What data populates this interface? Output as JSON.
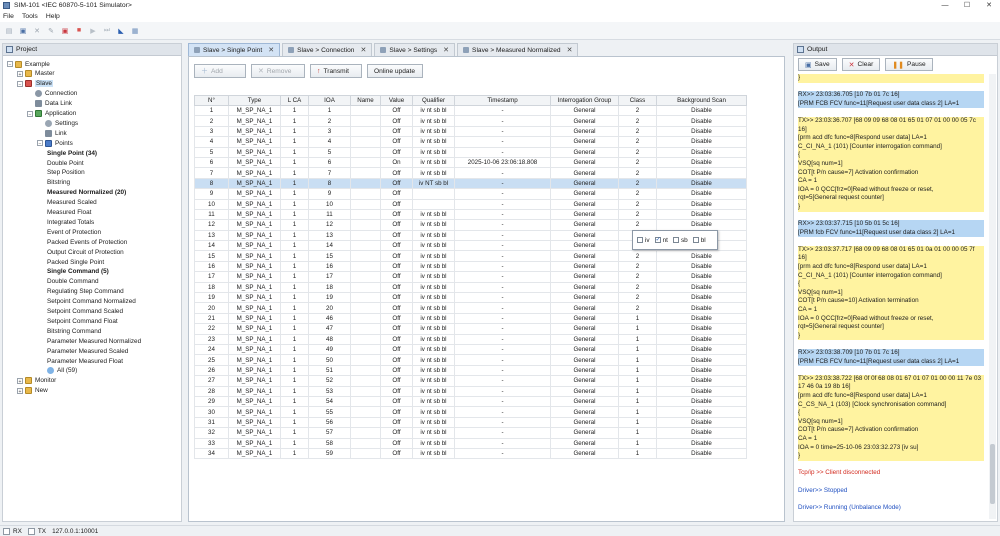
{
  "window": {
    "title": "SIM-101 <IEC 60870-5-101 Simulator>",
    "minimize": "—",
    "maximize": "☐",
    "close": "✕"
  },
  "menu": [
    "File",
    "Tools",
    "Help"
  ],
  "project": {
    "header": "Project",
    "tree": [
      {
        "label": "Example",
        "level": 0,
        "icon": "folder-icon",
        "expander": "−"
      },
      {
        "label": "Master",
        "level": 1,
        "icon": "folder-icon",
        "expander": "+"
      },
      {
        "label": "Slave",
        "level": 1,
        "icon": "slave-icon",
        "expander": "−",
        "selected": true
      },
      {
        "label": "Connection",
        "level": 2,
        "icon": "connection-icon"
      },
      {
        "label": "Data Link",
        "level": 2,
        "icon": "link-icon"
      },
      {
        "label": "Application",
        "level": 2,
        "icon": "application-icon",
        "expander": "−"
      },
      {
        "label": "Settings",
        "level": 3,
        "icon": "settings-icon"
      },
      {
        "label": "Link",
        "level": 3,
        "icon": "link-icon"
      },
      {
        "label": "Points",
        "level": 3,
        "icon": "points-icon",
        "expander": "−"
      },
      {
        "label": "Single Point (34)",
        "level": 4,
        "bold": true
      },
      {
        "label": "Double Point",
        "level": 4
      },
      {
        "label": "Step Position",
        "level": 4
      },
      {
        "label": "Bitstring",
        "level": 4
      },
      {
        "label": "Measured Normalized (20)",
        "level": 4,
        "bold": true
      },
      {
        "label": "Measured Scaled",
        "level": 4
      },
      {
        "label": "Measured Float",
        "level": 4
      },
      {
        "label": "Integrated Totals",
        "level": 4
      },
      {
        "label": "Event of Protection",
        "level": 4
      },
      {
        "label": "Packed Events of Protection",
        "level": 4
      },
      {
        "label": "Output Circuit of Protection",
        "level": 4
      },
      {
        "label": "Packed Single Point",
        "level": 4
      },
      {
        "label": "Single Command (5)",
        "level": 4,
        "bold": true
      },
      {
        "label": "Double Command",
        "level": 4
      },
      {
        "label": "Regulating Step Command",
        "level": 4
      },
      {
        "label": "Setpoint Command Normalized",
        "level": 4
      },
      {
        "label": "Setpoint Command Scaled",
        "level": 4
      },
      {
        "label": "Setpoint Command Float",
        "level": 4
      },
      {
        "label": "Bitstring Command",
        "level": 4
      },
      {
        "label": "Parameter Measured Normalized",
        "level": 4
      },
      {
        "label": "Parameter Measured Scaled",
        "level": 4
      },
      {
        "label": "Parameter Measured Float",
        "level": 4
      },
      {
        "label": "All (59)",
        "level": 4,
        "icon": "all-icon"
      },
      {
        "label": "Monitor",
        "level": 1,
        "icon": "folder-icon",
        "expander": "+"
      },
      {
        "label": "New",
        "level": 1,
        "icon": "folder-icon",
        "expander": "+"
      }
    ]
  },
  "tabs": [
    {
      "label": "Slave > Single Point",
      "active": true
    },
    {
      "label": "Slave > Connection"
    },
    {
      "label": "Slave > Settings"
    },
    {
      "label": "Slave > Measured Normalized"
    }
  ],
  "actions": {
    "add": "Add",
    "remove": "Remove",
    "transmit": "Transmit",
    "online_update": "Online update"
  },
  "table": {
    "headers": [
      "N°",
      "Type",
      "L CA",
      "IOA",
      "Name",
      "Value",
      "Qualifier",
      "Timestamp",
      "Interrogation Group",
      "Class",
      "Background Scan"
    ],
    "rows": [
      [
        "1",
        "M_SP_NA_1",
        "1",
        "1",
        "",
        "Off",
        "iv nt sb bl",
        "-",
        "General",
        "2",
        "Disable"
      ],
      [
        "2",
        "M_SP_NA_1",
        "1",
        "2",
        "",
        "Off",
        "iv nt sb bl",
        "-",
        "General",
        "2",
        "Disable"
      ],
      [
        "3",
        "M_SP_NA_1",
        "1",
        "3",
        "",
        "Off",
        "iv nt sb bl",
        "-",
        "General",
        "2",
        "Disable"
      ],
      [
        "4",
        "M_SP_NA_1",
        "1",
        "4",
        "",
        "Off",
        "iv nt sb bl",
        "-",
        "General",
        "2",
        "Disable"
      ],
      [
        "5",
        "M_SP_NA_1",
        "1",
        "5",
        "",
        "Off",
        "iv nt sb bl",
        "-",
        "General",
        "2",
        "Disable"
      ],
      [
        "6",
        "M_SP_NA_1",
        "1",
        "6",
        "",
        "On",
        "iv nt sb bl",
        "2025-10-06 23:06:18.808",
        "General",
        "2",
        "Disable"
      ],
      [
        "7",
        "M_SP_NA_1",
        "1",
        "7",
        "",
        "Off",
        "iv nt sb bl",
        "-",
        "General",
        "2",
        "Disable"
      ],
      [
        "8",
        "M_SP_NA_1",
        "1",
        "8",
        "",
        "Off",
        "iv NT sb bl",
        "-",
        "General",
        "2",
        "Disable"
      ],
      [
        "9",
        "M_SP_NA_1",
        "1",
        "9",
        "",
        "Off",
        "",
        "-",
        "General",
        "2",
        "Disable"
      ],
      [
        "10",
        "M_SP_NA_1",
        "1",
        "10",
        "",
        "Off",
        "",
        "-",
        "General",
        "2",
        "Disable"
      ],
      [
        "11",
        "M_SP_NA_1",
        "1",
        "11",
        "",
        "Off",
        "iv nt sb bl",
        "-",
        "General",
        "2",
        "Disable"
      ],
      [
        "12",
        "M_SP_NA_1",
        "1",
        "12",
        "",
        "Off",
        "iv nt sb bl",
        "-",
        "General",
        "2",
        "Disable"
      ],
      [
        "13",
        "M_SP_NA_1",
        "1",
        "13",
        "",
        "Off",
        "iv nt sb bl",
        "-",
        "General",
        "2",
        "Disable"
      ],
      [
        "14",
        "M_SP_NA_1",
        "1",
        "14",
        "",
        "Off",
        "iv nt sb bl",
        "-",
        "General",
        "2",
        "Disable"
      ],
      [
        "15",
        "M_SP_NA_1",
        "1",
        "15",
        "",
        "Off",
        "iv nt sb bl",
        "-",
        "General",
        "2",
        "Disable"
      ],
      [
        "16",
        "M_SP_NA_1",
        "1",
        "16",
        "",
        "Off",
        "iv nt sb bl",
        "-",
        "General",
        "2",
        "Disable"
      ],
      [
        "17",
        "M_SP_NA_1",
        "1",
        "17",
        "",
        "Off",
        "iv nt sb bl",
        "-",
        "General",
        "2",
        "Disable"
      ],
      [
        "18",
        "M_SP_NA_1",
        "1",
        "18",
        "",
        "Off",
        "iv nt sb bl",
        "-",
        "General",
        "2",
        "Disable"
      ],
      [
        "19",
        "M_SP_NA_1",
        "1",
        "19",
        "",
        "Off",
        "iv nt sb bl",
        "-",
        "General",
        "2",
        "Disable"
      ],
      [
        "20",
        "M_SP_NA_1",
        "1",
        "20",
        "",
        "Off",
        "iv nt sb bl",
        "-",
        "General",
        "2",
        "Disable"
      ],
      [
        "21",
        "M_SP_NA_1",
        "1",
        "46",
        "",
        "Off",
        "iv nt sb bl",
        "-",
        "General",
        "1",
        "Disable"
      ],
      [
        "22",
        "M_SP_NA_1",
        "1",
        "47",
        "",
        "Off",
        "iv nt sb bl",
        "-",
        "General",
        "1",
        "Disable"
      ],
      [
        "23",
        "M_SP_NA_1",
        "1",
        "48",
        "",
        "Off",
        "iv nt sb bl",
        "-",
        "General",
        "1",
        "Disable"
      ],
      [
        "24",
        "M_SP_NA_1",
        "1",
        "49",
        "",
        "Off",
        "iv nt sb bl",
        "-",
        "General",
        "1",
        "Disable"
      ],
      [
        "25",
        "M_SP_NA_1",
        "1",
        "50",
        "",
        "Off",
        "iv nt sb bl",
        "-",
        "General",
        "1",
        "Disable"
      ],
      [
        "26",
        "M_SP_NA_1",
        "1",
        "51",
        "",
        "Off",
        "iv nt sb bl",
        "-",
        "General",
        "1",
        "Disable"
      ],
      [
        "27",
        "M_SP_NA_1",
        "1",
        "52",
        "",
        "Off",
        "iv nt sb bl",
        "-",
        "General",
        "1",
        "Disable"
      ],
      [
        "28",
        "M_SP_NA_1",
        "1",
        "53",
        "",
        "Off",
        "iv nt sb bl",
        "-",
        "General",
        "1",
        "Disable"
      ],
      [
        "29",
        "M_SP_NA_1",
        "1",
        "54",
        "",
        "Off",
        "iv nt sb bl",
        "-",
        "General",
        "1",
        "Disable"
      ],
      [
        "30",
        "M_SP_NA_1",
        "1",
        "55",
        "",
        "Off",
        "iv nt sb bl",
        "-",
        "General",
        "1",
        "Disable"
      ],
      [
        "31",
        "M_SP_NA_1",
        "1",
        "56",
        "",
        "Off",
        "iv nt sb bl",
        "-",
        "General",
        "1",
        "Disable"
      ],
      [
        "32",
        "M_SP_NA_1",
        "1",
        "57",
        "",
        "Off",
        "iv nt sb bl",
        "-",
        "General",
        "1",
        "Disable"
      ],
      [
        "33",
        "M_SP_NA_1",
        "1",
        "58",
        "",
        "Off",
        "iv nt sb bl",
        "-",
        "General",
        "1",
        "Disable"
      ],
      [
        "34",
        "M_SP_NA_1",
        "1",
        "59",
        "",
        "Off",
        "iv nt sb bl",
        "-",
        "General",
        "1",
        "Disable"
      ]
    ],
    "selected_row": 8
  },
  "qualifier_popup": {
    "options": [
      {
        "label": "iv",
        "checked": false
      },
      {
        "label": "nt",
        "checked": true
      },
      {
        "label": "sb",
        "checked": false
      },
      {
        "label": "bl",
        "checked": false
      }
    ]
  },
  "output": {
    "header": "Output",
    "buttons": {
      "save": "Save",
      "clear": "Clear",
      "pause": "Pause"
    },
    "lines": [
      {
        "t": "        }",
        "c": "yellow"
      },
      {
        "t": "",
        "c": ""
      },
      {
        "t": "RX>> 23:03:36.705 [10 7b 01 7c 16]",
        "c": "blue"
      },
      {
        "t": "    [PRM FCB FCV func=11[Request user data class 2] LA=1",
        "c": "blue"
      },
      {
        "t": "",
        "c": ""
      },
      {
        "t": "TX>> 23:03:36.707 [68 09 09 68 08 01 65 01 07 01 00 00 05 7c",
        "c": "yellow"
      },
      {
        "t": "16]",
        "c": "yellow"
      },
      {
        "t": "  [prm acd dfc func=8[Respond user data] LA=1",
        "c": "yellow"
      },
      {
        "t": "      C_CI_NA_1 (101) [Counter interrogation command]",
        "c": "yellow"
      },
      {
        "t": "        {",
        "c": "yellow"
      },
      {
        "t": "          VSQ[sq num=1]",
        "c": "yellow"
      },
      {
        "t": "          COT[t P/n cause=7] Activation confirmation",
        "c": "yellow"
      },
      {
        "t": "          CA = 1",
        "c": "yellow"
      },
      {
        "t": "          IOA = 0 QCC[frz=0]Read without freeze or reset,",
        "c": "yellow"
      },
      {
        "t": "rqt=5[General request counter]",
        "c": "yellow"
      },
      {
        "t": "        }",
        "c": "yellow"
      },
      {
        "t": "",
        "c": ""
      },
      {
        "t": "RX>> 23:03:37.715 [10 5b 01 5c 16]",
        "c": "blue"
      },
      {
        "t": "    [PRM fcb FCV func=11[Request user data class 2] LA=1",
        "c": "blue"
      },
      {
        "t": "",
        "c": ""
      },
      {
        "t": "TX>> 23:03:37.717 [68 09 09 68 08 01 65 01 0a 01 00 00 05 7f",
        "c": "yellow"
      },
      {
        "t": "16]",
        "c": "yellow"
      },
      {
        "t": "  [prm acd dfc func=8[Respond user data] LA=1",
        "c": "yellow"
      },
      {
        "t": "      C_CI_NA_1 (101) [Counter interrogation command]",
        "c": "yellow"
      },
      {
        "t": "        {",
        "c": "yellow"
      },
      {
        "t": "          VSQ[sq num=1]",
        "c": "yellow"
      },
      {
        "t": "          COT[t P/n cause=10] Activation termination",
        "c": "yellow"
      },
      {
        "t": "          CA = 1",
        "c": "yellow"
      },
      {
        "t": "          IOA = 0 QCC[frz=0]Read without freeze or reset,",
        "c": "yellow"
      },
      {
        "t": "rqt=5[General request counter]",
        "c": "yellow"
      },
      {
        "t": "        }",
        "c": "yellow"
      },
      {
        "t": "",
        "c": ""
      },
      {
        "t": "RX>> 23:03:38.709 [10 7b 01 7c 16]",
        "c": "blue"
      },
      {
        "t": "    [PRM FCB FCV func=11[Request user data class 2] LA=1",
        "c": "blue"
      },
      {
        "t": "",
        "c": ""
      },
      {
        "t": "TX>> 23:03:38.722 [68 0f 0f 68 08 01 67 01 07 01 00 00 11 7e 03",
        "c": "yellow"
      },
      {
        "t": "17 46 0a 19 8b 16]",
        "c": "yellow"
      },
      {
        "t": "  [prm acd dfc func=8[Respond user data] LA=1",
        "c": "yellow"
      },
      {
        "t": "      C_CS_NA_1 (103) [Clock synchronisation command]",
        "c": "yellow"
      },
      {
        "t": "        {",
        "c": "yellow"
      },
      {
        "t": "          VSQ[sq num=1]",
        "c": "yellow"
      },
      {
        "t": "          COT[t P/n cause=7] Activation confirmation",
        "c": "yellow"
      },
      {
        "t": "          CA = 1",
        "c": "yellow"
      },
      {
        "t": "          IOA = 0 time=25-10-06 23:03:32.273 [iv su]",
        "c": "yellow"
      },
      {
        "t": "        }",
        "c": "yellow"
      },
      {
        "t": "",
        "c": ""
      },
      {
        "t": "Tcp/ip >> Client disconnected",
        "c": "red"
      },
      {
        "t": "",
        "c": ""
      },
      {
        "t": "Driver>> Stopped",
        "c": "bluetext"
      },
      {
        "t": "",
        "c": ""
      },
      {
        "t": "Driver>> Running  (Unbalance Mode)",
        "c": "bluetext"
      }
    ]
  },
  "status": {
    "rx": "RX",
    "tx": "TX",
    "address": "127.0.0.1:10001"
  },
  "colors": {
    "selection": "#c9def3",
    "highlight_yellow": "#fff3a0",
    "highlight_blue": "#b6d6f3",
    "error": "#d22a1e",
    "info": "#1f4fc0"
  }
}
